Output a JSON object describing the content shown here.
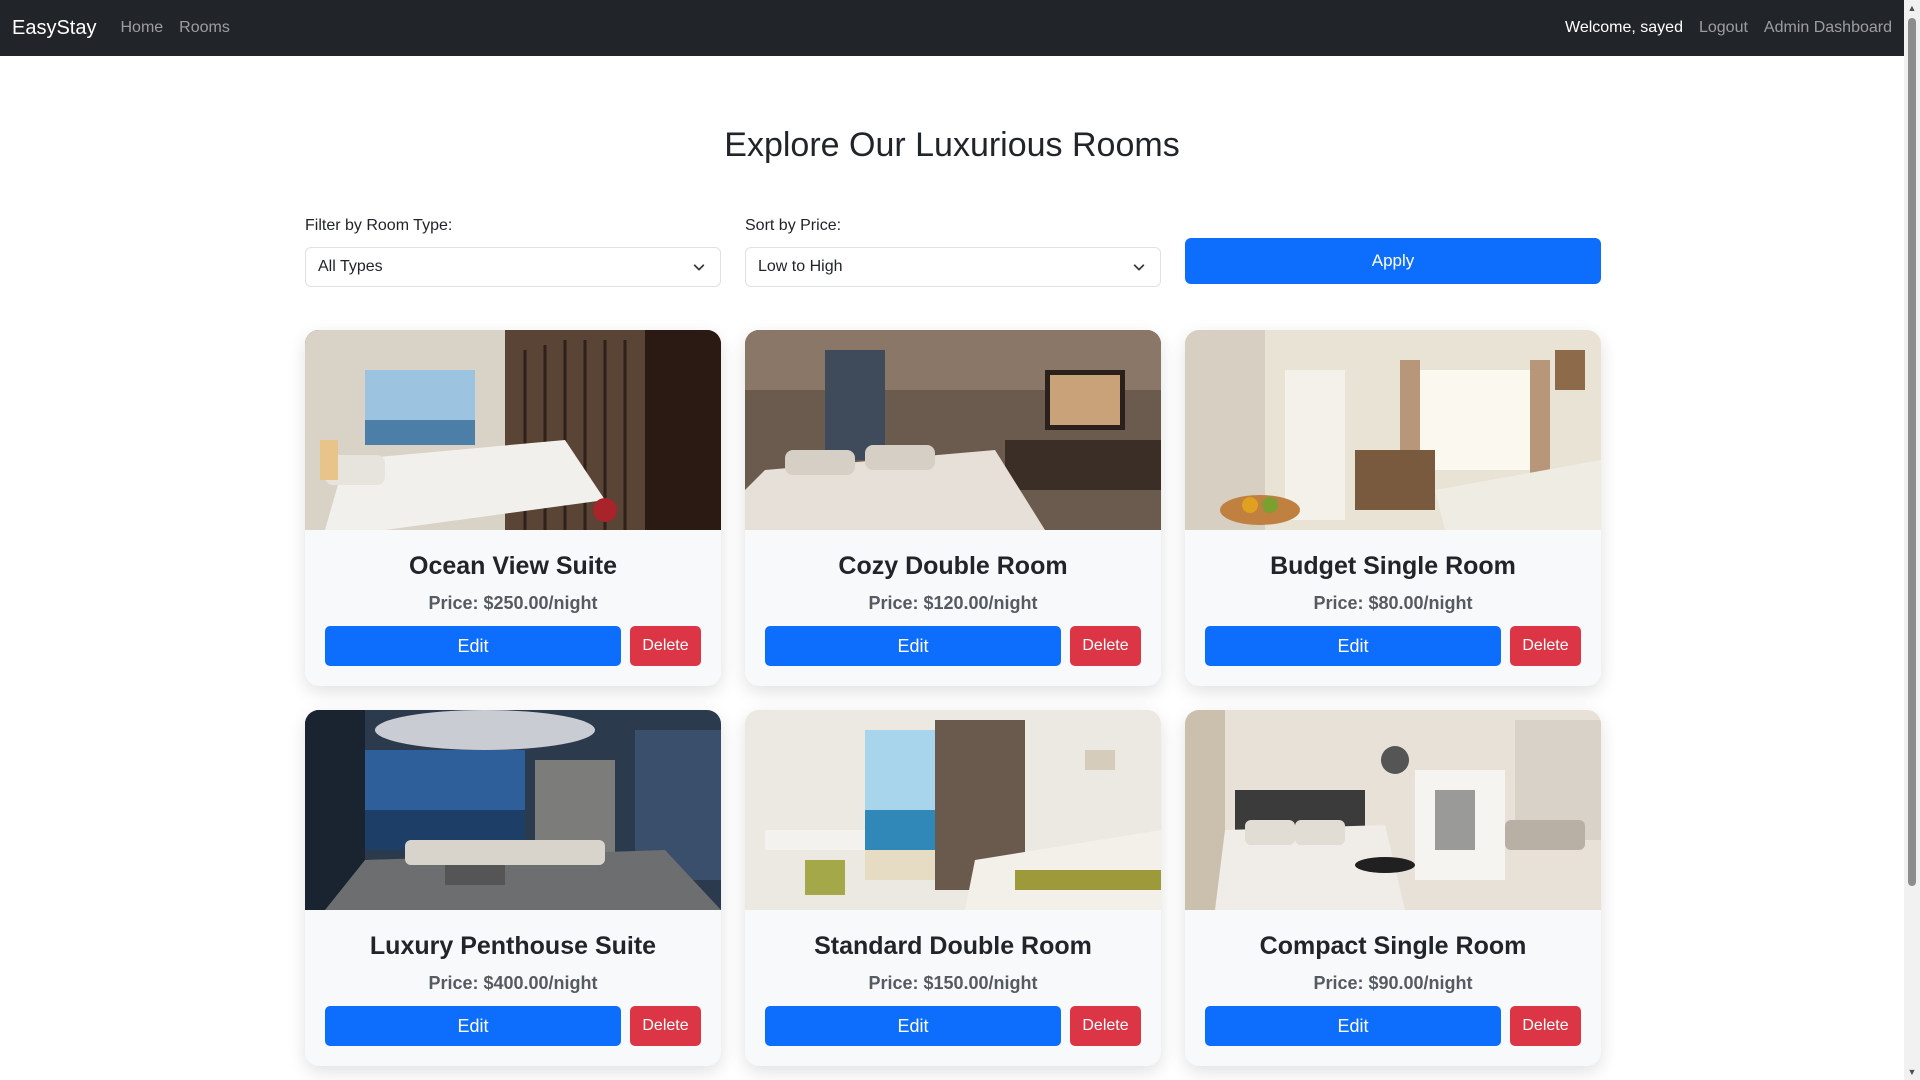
{
  "nav": {
    "brand": "EasyStay",
    "links": [
      "Home",
      "Rooms"
    ],
    "welcome": "Welcome, sayed",
    "logout": "Logout",
    "admin": "Admin Dashboard"
  },
  "page_title": "Explore Our Luxurious Rooms",
  "filters": {
    "type_label": "Filter by Room Type:",
    "type_value": "All Types",
    "sort_label": "Sort by Price:",
    "sort_value": "Low to High",
    "apply": "Apply"
  },
  "rooms": [
    {
      "name": "Ocean View Suite",
      "price": "Price: $250.00/night",
      "edit": "Edit",
      "delete": "Delete"
    },
    {
      "name": "Cozy Double Room",
      "price": "Price: $120.00/night",
      "edit": "Edit",
      "delete": "Delete"
    },
    {
      "name": "Budget Single Room",
      "price": "Price: $80.00/night",
      "edit": "Edit",
      "delete": "Delete"
    },
    {
      "name": "Luxury Penthouse Suite",
      "price": "Price: $400.00/night",
      "edit": "Edit",
      "delete": "Delete"
    },
    {
      "name": "Standard Double Room",
      "price": "Price: $150.00/night",
      "edit": "Edit",
      "delete": "Delete"
    },
    {
      "name": "Compact Single Room",
      "price": "Price: $90.00/night",
      "edit": "Edit",
      "delete": "Delete"
    }
  ],
  "colors": {
    "navbar": "#212529",
    "primary": "#0d6efd",
    "danger": "#dc3545"
  }
}
